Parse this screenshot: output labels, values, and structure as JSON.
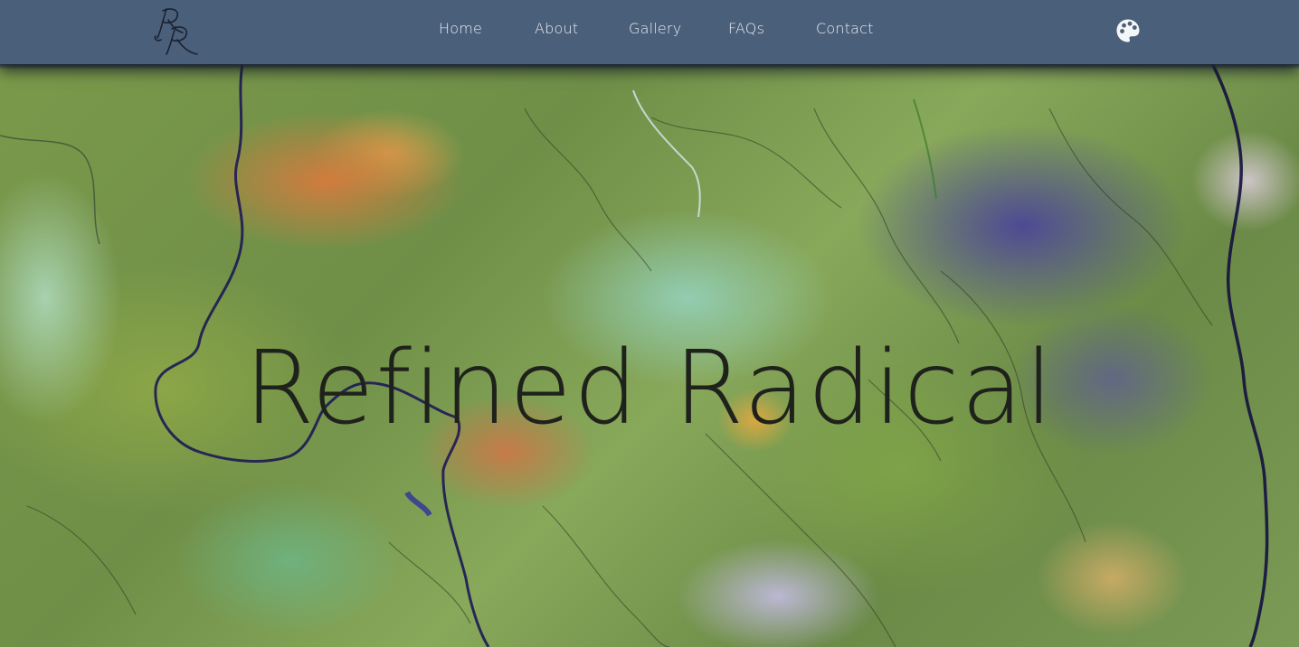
{
  "brand": {
    "logo_icon": "rr-monogram-logo"
  },
  "nav": {
    "items": [
      {
        "label": "Home"
      },
      {
        "label": "About"
      },
      {
        "label": "Gallery"
      },
      {
        "label": "FAQs"
      },
      {
        "label": "Contact"
      }
    ],
    "palette_icon": "palette-icon"
  },
  "hero": {
    "title": "Refined Radical",
    "background": "satellite terrain image"
  },
  "colors": {
    "navbar": "#4a5f7a",
    "nav_text": "#e8ecf2",
    "title_text": "#1f221c"
  }
}
